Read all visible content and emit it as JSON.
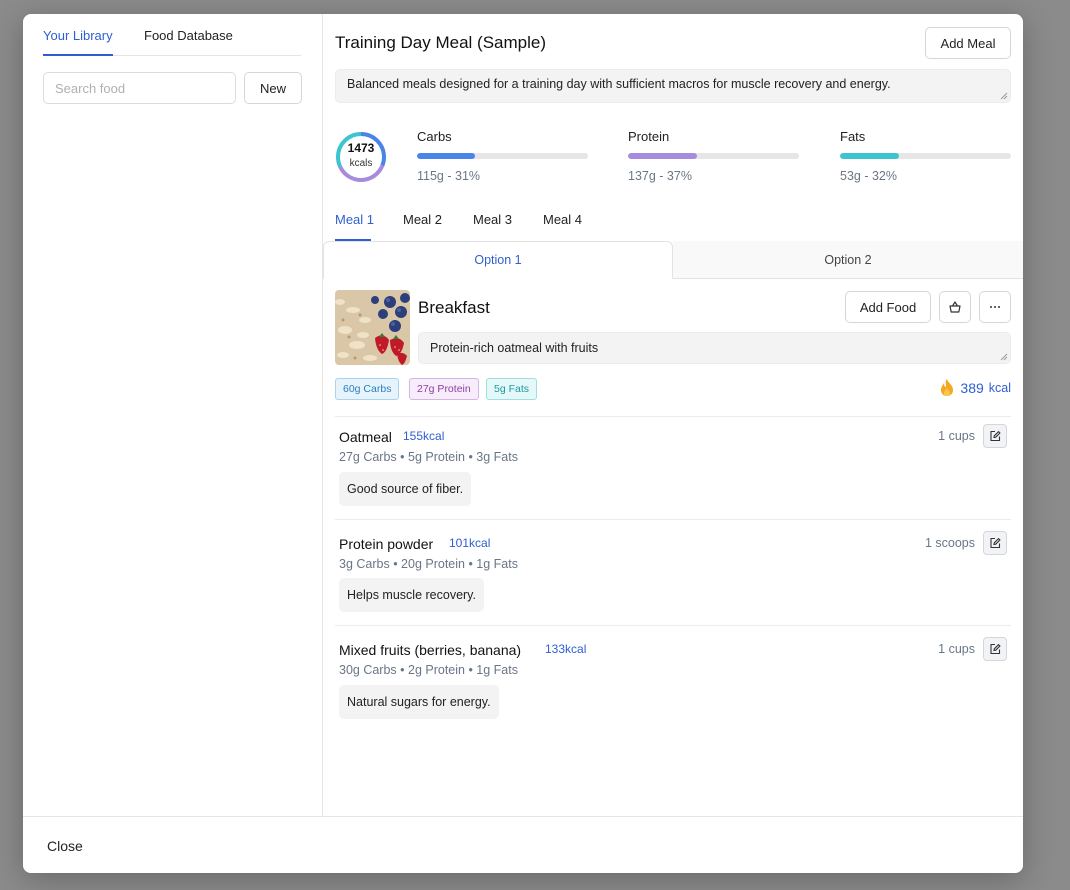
{
  "library_panel": {
    "tabs": [
      {
        "label": "Your Library",
        "active": true
      },
      {
        "label": "Food Database",
        "active": false
      }
    ],
    "search_placeholder": "Search food",
    "new_button": "New"
  },
  "plan": {
    "title": "Training Day Meal (Sample)",
    "add_meal_button": "Add Meal",
    "description": "Balanced meals designed for a training day with sufficient macros for muscle recovery and energy.",
    "calories": {
      "value": "1473",
      "unit": "kcals"
    },
    "macros": [
      {
        "label": "Carbs",
        "value": "115g - 31%",
        "percent": 31,
        "color": "#4a84e8"
      },
      {
        "label": "Protein",
        "value": "137g - 37%",
        "percent": 37,
        "color": "#a78bdc"
      },
      {
        "label": "Fats",
        "value": "53g - 32%",
        "percent": 32,
        "color": "#3cc4d0"
      }
    ]
  },
  "meal_tabs": [
    {
      "label": "Meal 1",
      "active": true
    },
    {
      "label": "Meal 2",
      "active": false
    },
    {
      "label": "Meal 3",
      "active": false
    },
    {
      "label": "Meal 4",
      "active": false
    }
  ],
  "option_tabs": [
    {
      "label": "Option 1",
      "active": true
    },
    {
      "label": "Option 2",
      "active": false
    }
  ],
  "meal": {
    "name": "Breakfast",
    "add_food_button": "Add Food",
    "description": "Protein-rich oatmeal with fruits",
    "badges": [
      {
        "label": "60g Carbs",
        "color": "#2a7fc1",
        "bg": "#e6f3fb",
        "border": "#a9d3ee"
      },
      {
        "label": "27g Protein",
        "color": "#8b3fa6",
        "bg": "#f7ecfa",
        "border": "#d8b3e6"
      },
      {
        "label": "5g Fats",
        "color": "#1d9aa2",
        "bg": "#e5f8f8",
        "border": "#9fdfe2"
      }
    ],
    "kcal": {
      "value": "389",
      "unit": "kcal"
    }
  },
  "foods": [
    {
      "name": "Oatmeal",
      "kcal": "155kcal",
      "macros": "27g Carbs • 5g Protein • 3g Fats",
      "note": "Good source of fiber.",
      "qty": "1 cups"
    },
    {
      "name": "Protein powder",
      "kcal": "101kcal",
      "macros": "3g Carbs • 20g Protein • 1g Fats",
      "note": "Helps muscle recovery.",
      "qty": "1 scoops"
    },
    {
      "name": "Mixed fruits (berries, banana)",
      "kcal": "133kcal",
      "macros": "30g Carbs • 2g Protein • 1g Fats",
      "note": "Natural sugars for energy.",
      "qty": "1 cups"
    }
  ],
  "footer": {
    "close_button": "Close"
  },
  "icons": {
    "meal_actions": [
      "basket-icon",
      "more-icon"
    ],
    "food_action": "edit-icon",
    "calorie": "fire-icon"
  }
}
